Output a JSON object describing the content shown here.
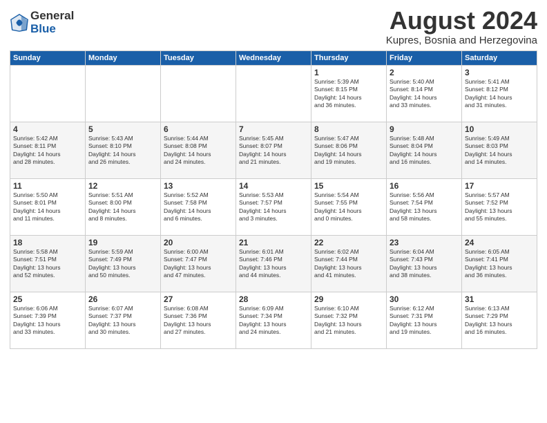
{
  "header": {
    "logo_general": "General",
    "logo_blue": "Blue",
    "month_title": "August 2024",
    "location": "Kupres, Bosnia and Herzegovina"
  },
  "days_of_week": [
    "Sunday",
    "Monday",
    "Tuesday",
    "Wednesday",
    "Thursday",
    "Friday",
    "Saturday"
  ],
  "weeks": [
    [
      {
        "day": "",
        "info": ""
      },
      {
        "day": "",
        "info": ""
      },
      {
        "day": "",
        "info": ""
      },
      {
        "day": "",
        "info": ""
      },
      {
        "day": "1",
        "info": "Sunrise: 5:39 AM\nSunset: 8:15 PM\nDaylight: 14 hours\nand 36 minutes."
      },
      {
        "day": "2",
        "info": "Sunrise: 5:40 AM\nSunset: 8:14 PM\nDaylight: 14 hours\nand 33 minutes."
      },
      {
        "day": "3",
        "info": "Sunrise: 5:41 AM\nSunset: 8:12 PM\nDaylight: 14 hours\nand 31 minutes."
      }
    ],
    [
      {
        "day": "4",
        "info": "Sunrise: 5:42 AM\nSunset: 8:11 PM\nDaylight: 14 hours\nand 28 minutes."
      },
      {
        "day": "5",
        "info": "Sunrise: 5:43 AM\nSunset: 8:10 PM\nDaylight: 14 hours\nand 26 minutes."
      },
      {
        "day": "6",
        "info": "Sunrise: 5:44 AM\nSunset: 8:08 PM\nDaylight: 14 hours\nand 24 minutes."
      },
      {
        "day": "7",
        "info": "Sunrise: 5:45 AM\nSunset: 8:07 PM\nDaylight: 14 hours\nand 21 minutes."
      },
      {
        "day": "8",
        "info": "Sunrise: 5:47 AM\nSunset: 8:06 PM\nDaylight: 14 hours\nand 19 minutes."
      },
      {
        "day": "9",
        "info": "Sunrise: 5:48 AM\nSunset: 8:04 PM\nDaylight: 14 hours\nand 16 minutes."
      },
      {
        "day": "10",
        "info": "Sunrise: 5:49 AM\nSunset: 8:03 PM\nDaylight: 14 hours\nand 14 minutes."
      }
    ],
    [
      {
        "day": "11",
        "info": "Sunrise: 5:50 AM\nSunset: 8:01 PM\nDaylight: 14 hours\nand 11 minutes."
      },
      {
        "day": "12",
        "info": "Sunrise: 5:51 AM\nSunset: 8:00 PM\nDaylight: 14 hours\nand 8 minutes."
      },
      {
        "day": "13",
        "info": "Sunrise: 5:52 AM\nSunset: 7:58 PM\nDaylight: 14 hours\nand 6 minutes."
      },
      {
        "day": "14",
        "info": "Sunrise: 5:53 AM\nSunset: 7:57 PM\nDaylight: 14 hours\nand 3 minutes."
      },
      {
        "day": "15",
        "info": "Sunrise: 5:54 AM\nSunset: 7:55 PM\nDaylight: 14 hours\nand 0 minutes."
      },
      {
        "day": "16",
        "info": "Sunrise: 5:56 AM\nSunset: 7:54 PM\nDaylight: 13 hours\nand 58 minutes."
      },
      {
        "day": "17",
        "info": "Sunrise: 5:57 AM\nSunset: 7:52 PM\nDaylight: 13 hours\nand 55 minutes."
      }
    ],
    [
      {
        "day": "18",
        "info": "Sunrise: 5:58 AM\nSunset: 7:51 PM\nDaylight: 13 hours\nand 52 minutes."
      },
      {
        "day": "19",
        "info": "Sunrise: 5:59 AM\nSunset: 7:49 PM\nDaylight: 13 hours\nand 50 minutes."
      },
      {
        "day": "20",
        "info": "Sunrise: 6:00 AM\nSunset: 7:47 PM\nDaylight: 13 hours\nand 47 minutes."
      },
      {
        "day": "21",
        "info": "Sunrise: 6:01 AM\nSunset: 7:46 PM\nDaylight: 13 hours\nand 44 minutes."
      },
      {
        "day": "22",
        "info": "Sunrise: 6:02 AM\nSunset: 7:44 PM\nDaylight: 13 hours\nand 41 minutes."
      },
      {
        "day": "23",
        "info": "Sunrise: 6:04 AM\nSunset: 7:43 PM\nDaylight: 13 hours\nand 38 minutes."
      },
      {
        "day": "24",
        "info": "Sunrise: 6:05 AM\nSunset: 7:41 PM\nDaylight: 13 hours\nand 36 minutes."
      }
    ],
    [
      {
        "day": "25",
        "info": "Sunrise: 6:06 AM\nSunset: 7:39 PM\nDaylight: 13 hours\nand 33 minutes."
      },
      {
        "day": "26",
        "info": "Sunrise: 6:07 AM\nSunset: 7:37 PM\nDaylight: 13 hours\nand 30 minutes."
      },
      {
        "day": "27",
        "info": "Sunrise: 6:08 AM\nSunset: 7:36 PM\nDaylight: 13 hours\nand 27 minutes."
      },
      {
        "day": "28",
        "info": "Sunrise: 6:09 AM\nSunset: 7:34 PM\nDaylight: 13 hours\nand 24 minutes."
      },
      {
        "day": "29",
        "info": "Sunrise: 6:10 AM\nSunset: 7:32 PM\nDaylight: 13 hours\nand 21 minutes."
      },
      {
        "day": "30",
        "info": "Sunrise: 6:12 AM\nSunset: 7:31 PM\nDaylight: 13 hours\nand 19 minutes."
      },
      {
        "day": "31",
        "info": "Sunrise: 6:13 AM\nSunset: 7:29 PM\nDaylight: 13 hours\nand 16 minutes."
      }
    ]
  ]
}
